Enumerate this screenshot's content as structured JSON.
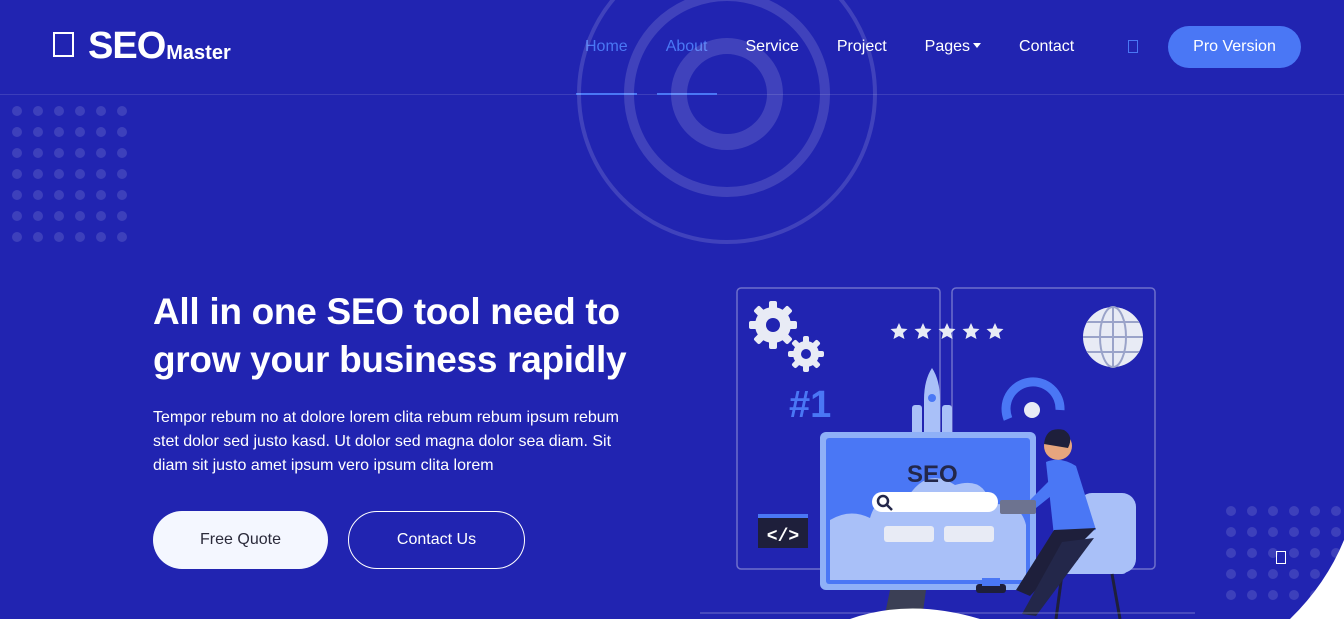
{
  "brand": {
    "name_big": "SEO",
    "name_small": "Master"
  },
  "nav": {
    "items": [
      {
        "label": "Home",
        "active": true
      },
      {
        "label": "About",
        "active": true
      },
      {
        "label": "Service",
        "active": false
      },
      {
        "label": "Project",
        "active": false
      },
      {
        "label": "Pages",
        "active": false
      },
      {
        "label": "Contact",
        "active": false
      }
    ],
    "search_icon": "search-icon",
    "cta_label": "Pro Version"
  },
  "hero": {
    "title_line1": "All in one SEO tool need to",
    "title_line2": "grow your business rapidly",
    "text": "Tempor rebum no at dolore lorem clita rebum rebum ipsum rebum stet dolor sed justo kasd. Ut dolor sed magna dolor sea diam. Sit diam sit justo amet ipsum vero ipsum clita lorem",
    "primary_button": "Free Quote",
    "secondary_button": "Contact Us"
  },
  "illustration": {
    "rank_label": "#1",
    "screen_label": "SEO",
    "code_label": "</>",
    "stars": 5
  },
  "colors": {
    "background": "#2124b1",
    "accent": "#4a77f5",
    "light": "#f4f7ff"
  }
}
